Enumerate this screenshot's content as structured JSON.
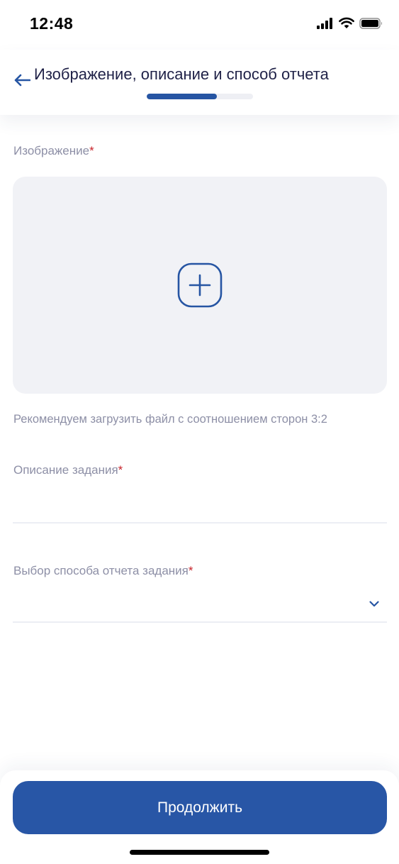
{
  "status_bar": {
    "time": "12:48",
    "icons": [
      "signal-icon",
      "wifi-icon",
      "battery-icon"
    ]
  },
  "header": {
    "title": "Изображение, описание  и способ отчета",
    "back_icon": "arrow-left-icon",
    "progress_fraction": 0.66,
    "progress_color": "#2655a3"
  },
  "form": {
    "image": {
      "label": "Изображение",
      "required_mark": "*",
      "add_icon": "plus-square-icon"
    },
    "hint": "Рекомендуем загрузить файл с соотношением сторон 3:2",
    "description": {
      "label": "Описание задания",
      "required_mark": "*",
      "value": ""
    },
    "report_method": {
      "label": "Выбор способа отчета задания",
      "required_mark": "*",
      "value": "",
      "icon": "chevron-down-icon"
    }
  },
  "footer": {
    "continue_label": "Продолжить"
  },
  "colors": {
    "accent": "#2856a6",
    "required": "#c8242b",
    "label": "#8d8fa6",
    "upload_background": "#f1f2f6"
  }
}
